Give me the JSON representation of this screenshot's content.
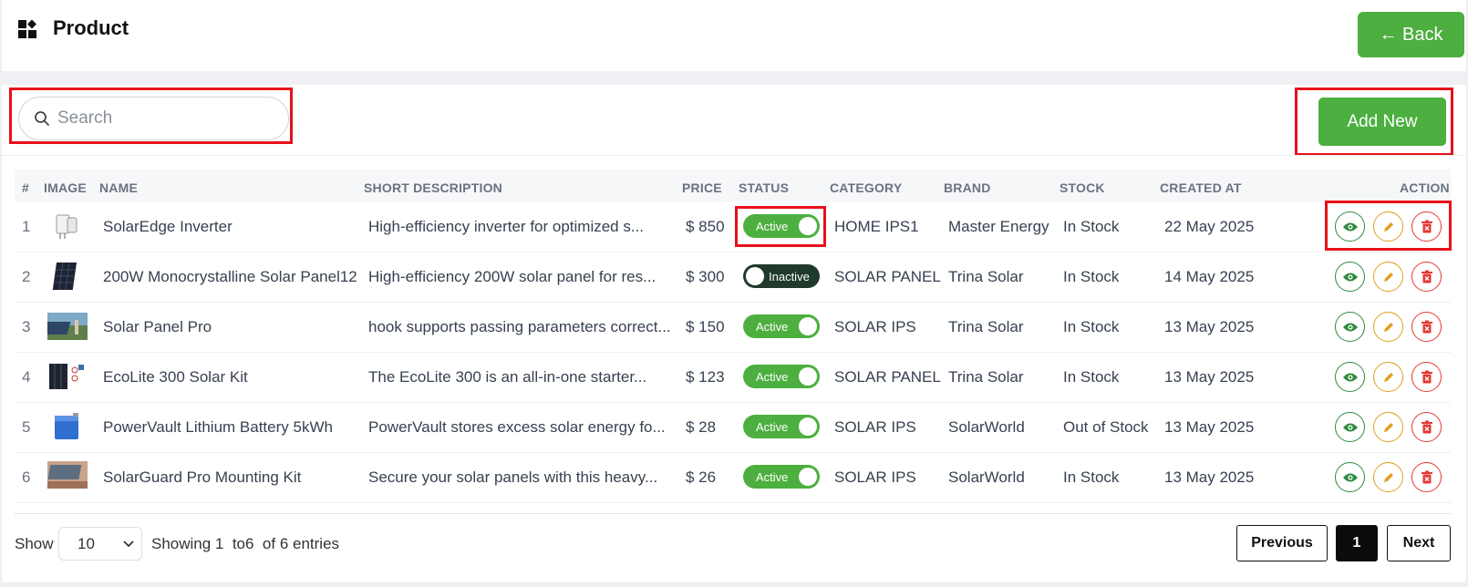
{
  "header": {
    "title": "Product",
    "back_label": "← Back",
    "logo_icon": "dashboard-icon"
  },
  "toolbar": {
    "search_placeholder": "Search",
    "search_value": "",
    "add_label": "Add New"
  },
  "table": {
    "columns": [
      "#",
      "IMAGE",
      "NAME",
      "SHORT DESCRIPTION",
      "PRICE",
      "STATUS",
      "CATEGORY",
      "BRAND",
      "STOCK",
      "CREATED AT",
      "ACTION"
    ],
    "rows": [
      {
        "num": "1",
        "image": "inverter-thumbnail",
        "name": "SolarEdge Inverter",
        "desc": "High-efficiency inverter for optimized s...",
        "price": "$ 850",
        "status": "Active",
        "active": true,
        "category": "HOME IPS1",
        "brand": "Master Energy",
        "stock": "In Stock",
        "created": "22 May 2025"
      },
      {
        "num": "2",
        "image": "panel-thumbnail",
        "name": "200W Monocrystalline Solar Panel12",
        "desc": "High-efficiency 200W solar panel for res...",
        "price": "$ 300",
        "status": "Inactive",
        "active": false,
        "category": "SOLAR PANEL",
        "brand": "Trina Solar",
        "stock": "In Stock",
        "created": "14 May 2025"
      },
      {
        "num": "3",
        "image": "panel-field-thumbnail",
        "name": "Solar Panel Pro",
        "desc": "hook supports passing parameters correct...",
        "price": "$ 150",
        "status": "Active",
        "active": true,
        "category": "SOLAR IPS",
        "brand": "Trina Solar",
        "stock": "In Stock",
        "created": "13 May 2025"
      },
      {
        "num": "4",
        "image": "kit-thumbnail",
        "name": "EcoLite 300 Solar Kit",
        "desc": "The EcoLite 300 is an all-in-one starter...",
        "price": "$ 123",
        "status": "Active",
        "active": true,
        "category": "SOLAR PANEL",
        "brand": "Trina Solar",
        "stock": "In Stock",
        "created": "13 May 2025"
      },
      {
        "num": "5",
        "image": "battery-thumbnail",
        "name": "PowerVault Lithium Battery 5kWh",
        "desc": "PowerVault stores excess solar energy fo...",
        "price": "$ 28",
        "status": "Active",
        "active": true,
        "category": "SOLAR IPS",
        "brand": "SolarWorld",
        "stock": "Out of Stock",
        "created": "13 May 2025"
      },
      {
        "num": "6",
        "image": "mounting-thumbnail",
        "name": "SolarGuard Pro Mounting Kit",
        "desc": "Secure your solar panels with this heavy...",
        "price": "$ 26",
        "status": "Active",
        "active": true,
        "category": "SOLAR IPS",
        "brand": "SolarWorld",
        "stock": "In Stock",
        "created": "13 May 2025"
      }
    ]
  },
  "footer": {
    "show_label": "Show",
    "page_size": "10",
    "showing_text": "Showing 1  to6  of 6 entries",
    "prev_label": "Previous",
    "current_page": "1",
    "next_label": "Next"
  },
  "colors": {
    "accent": "#4caf3f",
    "view": "#2e8b3e",
    "edit": "#e0a020",
    "delete": "#e53935",
    "highlight": "#e8101a",
    "inactive": "#1f3a2a"
  }
}
